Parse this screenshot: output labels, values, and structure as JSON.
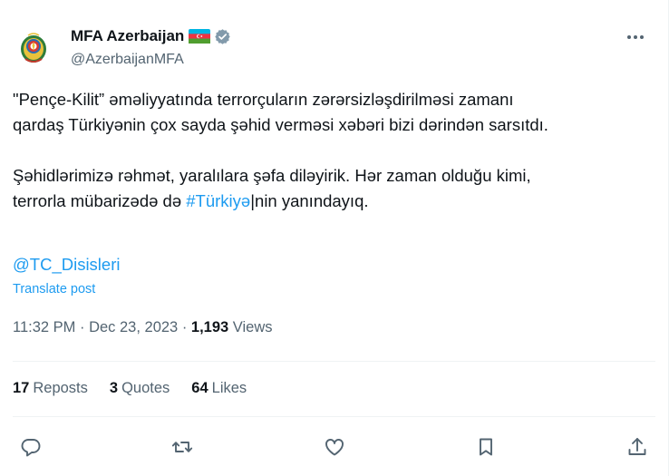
{
  "author": {
    "display_name": "MFA Azerbaijan",
    "handle": "@AzerbaijanMFA",
    "flag_icon": "azerbaijan-flag-icon",
    "verified_color": "#829aab"
  },
  "post": {
    "line1": "\"Pençe-Kilit” əməliyyatında terrorçuların zərərsizləşdirilməsi zamanı",
    "line2": "qardaş Türkiyənin çox sayda şəhid verməsi xəbəri bizi dərindən sarsıtdı.",
    "line3": "Şəhidlərimizə rəhmət, yaralılara şəfa diləyirik. Hər zaman olduğu kimi,",
    "line4_prefix": "terrorla mübarizədə də ",
    "hashtag": "#Türkiyə",
    "line4_suffix": "|nin yanındayıq.",
    "mention": "@TC_Disisleri",
    "translate_label": "Translate post"
  },
  "meta": {
    "time": "11:32 PM",
    "separator1": " · ",
    "date": "Dec 23, 2023",
    "separator2": " · ",
    "views_count": "1,193",
    "views_label": " Views"
  },
  "stats": {
    "reposts_count": "17",
    "reposts_label": "Reposts",
    "quotes_count": "3",
    "quotes_label": "Quotes",
    "likes_count": "64",
    "likes_label": "Likes"
  },
  "colors": {
    "link": "#1d9bf0",
    "muted": "#536471",
    "text": "#0f1419"
  }
}
